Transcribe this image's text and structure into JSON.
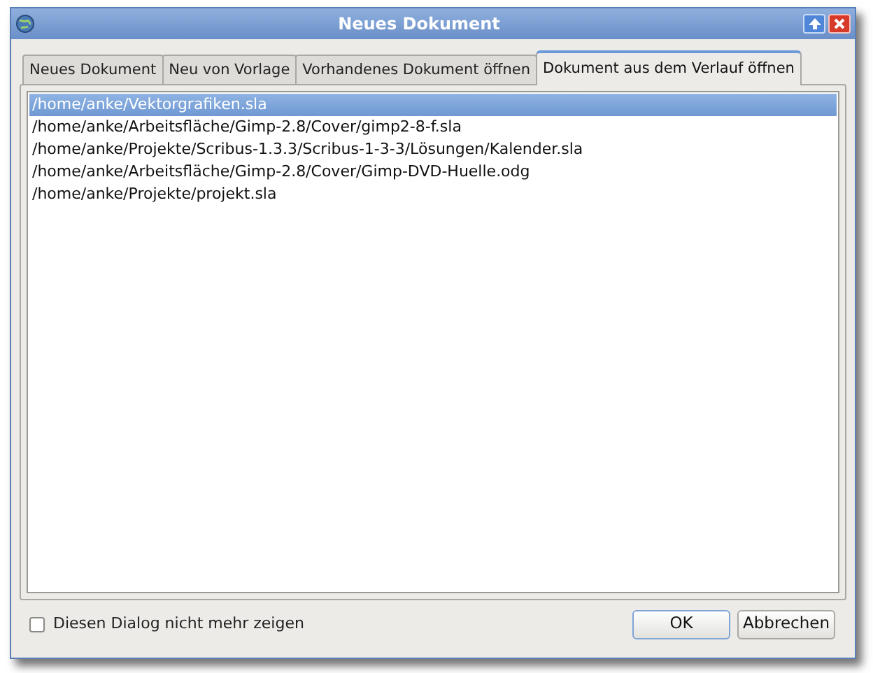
{
  "window": {
    "title": "Neues Dokument"
  },
  "tabs": [
    {
      "label": "Neues Dokument",
      "selected": false
    },
    {
      "label": "Neu von Vorlage",
      "selected": false
    },
    {
      "label": "Vorhandenes Dokument öffnen",
      "selected": false
    },
    {
      "label": "Dokument aus dem Verlauf öffnen",
      "selected": true
    }
  ],
  "recent_files": [
    {
      "path": "/home/anke/Vektorgrafiken.sla",
      "selected": true
    },
    {
      "path": "/home/anke/Arbeitsfläche/Gimp-2.8/Cover/gimp2-8-f.sla",
      "selected": false
    },
    {
      "path": "/home/anke/Projekte/Scribus-1.3.3/Scribus-1-3-3/Lösungen/Kalender.sla",
      "selected": false
    },
    {
      "path": "/home/anke/Arbeitsfläche/Gimp-2.8/Cover/Gimp-DVD-Huelle.odg",
      "selected": false
    },
    {
      "path": "/home/anke/Projekte/projekt.sla",
      "selected": false
    }
  ],
  "dont_show_again": {
    "label": "Diesen Dialog nicht mehr zeigen",
    "checked": false
  },
  "buttons": [
    {
      "label": "OK",
      "default": true
    },
    {
      "label": "Abbrechen",
      "default": false
    }
  ]
}
